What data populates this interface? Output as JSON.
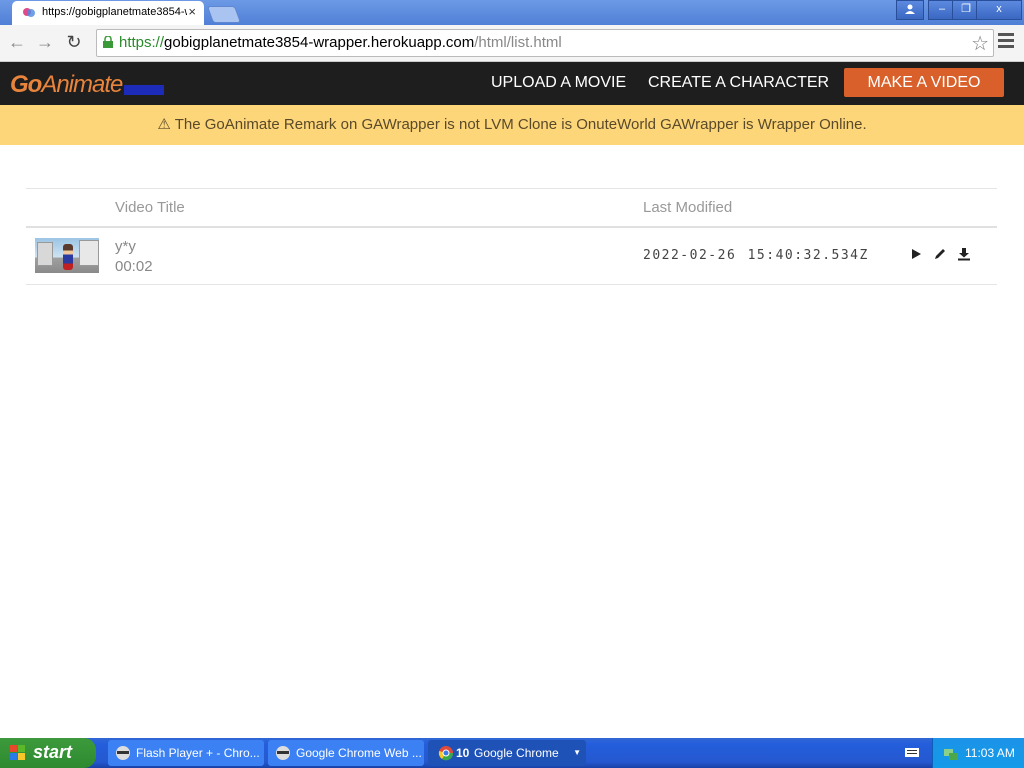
{
  "browser": {
    "tab_title": "https://gobigplanetmate3854-wrapper.herokuapp.com/html/list.html",
    "url_scheme": "https://",
    "url_host": "gobigplanetmate3854-wrapper.herokuapp.com",
    "url_path": "/html/list.html",
    "tab_close": "×",
    "window_controls": {
      "minimize": "–",
      "restore": "❐",
      "close": "x"
    }
  },
  "site": {
    "logo_go": "Go",
    "logo_rest": "Animate",
    "nav": {
      "upload": "UPLOAD A MOVIE",
      "create": "CREATE A CHARACTER",
      "make": "MAKE A VIDEO"
    },
    "notice_icon": "⚠",
    "notice": "The GoAnimate Remark on GAWrapper is not LVM Clone is OnuteWorld GAWrapper is Wrapper Online."
  },
  "table": {
    "headers": {
      "title": "Video Title",
      "modified": "Last Modified"
    },
    "rows": [
      {
        "title": "y*y",
        "duration": "00:02",
        "modified": "2022-02-26 15:40:32.534Z"
      }
    ]
  },
  "taskbar": {
    "start": "start",
    "tasks": [
      {
        "label": "Flash Player + - Chro..."
      },
      {
        "label": "Google Chrome Web ..."
      },
      {
        "count": "10",
        "label": "Google Chrome"
      }
    ],
    "clock": "11:03 AM"
  },
  "colors": {
    "accent_orange": "#d9602a",
    "notice_bg": "#fdd67a",
    "header_bg": "#1e1e1e"
  }
}
